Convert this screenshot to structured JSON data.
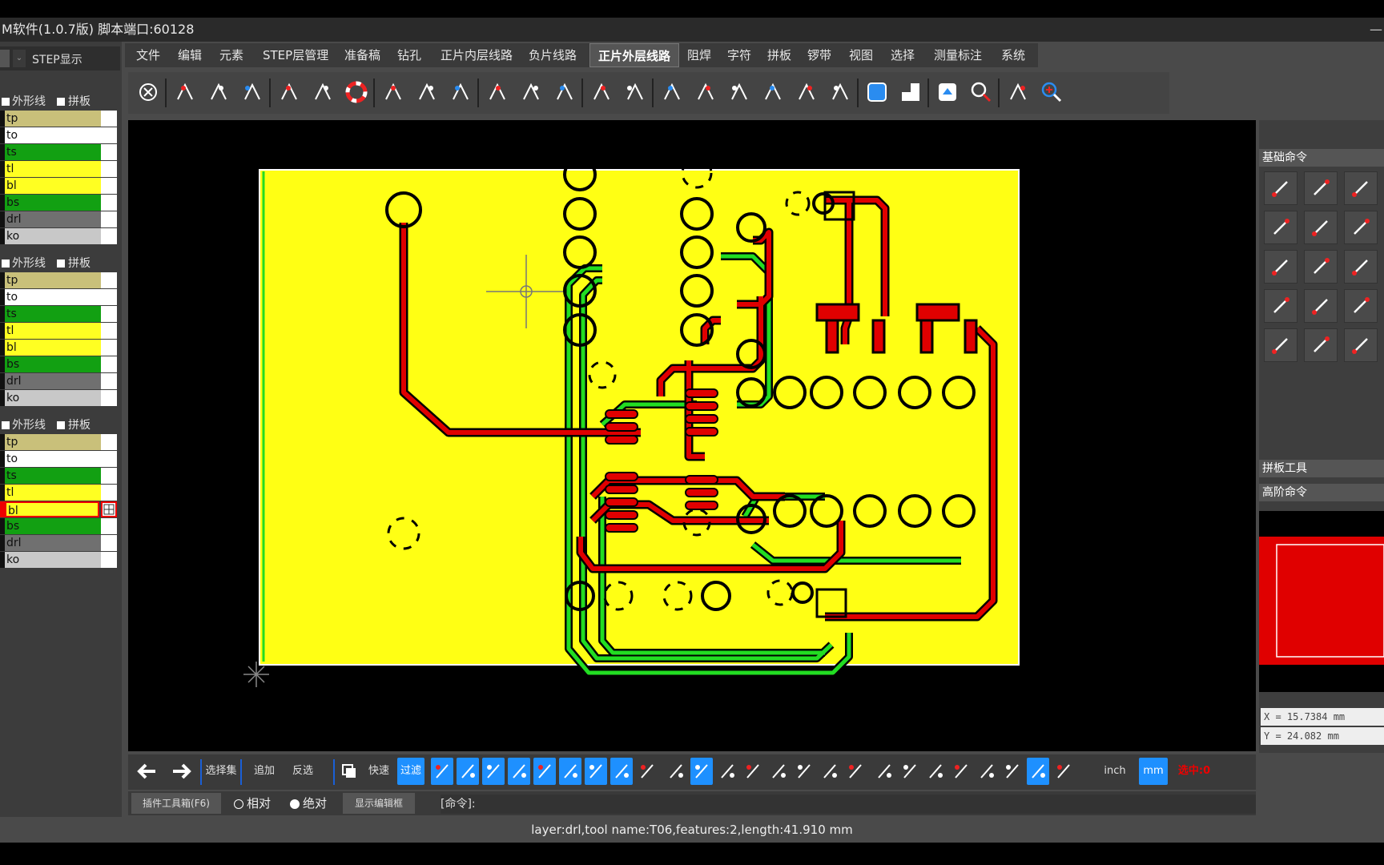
{
  "window": {
    "title": "M软件(1.0.7版) 脚本端口:60128",
    "min_glyph": "—"
  },
  "left_panel": {
    "header_label": "STEP显示",
    "groups": [
      {
        "check1": "外形线",
        "check2": "拼板",
        "layers": [
          "tp",
          "to",
          "ts",
          "tl",
          "bl",
          "bs",
          "drl",
          "ko"
        ]
      },
      {
        "check1": "外形线",
        "check2": "拼板",
        "layers": [
          "tp",
          "to",
          "ts",
          "tl",
          "bl",
          "bs",
          "drl",
          "ko"
        ]
      },
      {
        "check1": "外形线",
        "check2": "拼板",
        "layers": [
          "tp",
          "to",
          "ts",
          "tl",
          "bl",
          "bs",
          "drl",
          "ko"
        ],
        "selected_layer": "bl"
      }
    ],
    "layer_colors": {
      "tp": "#c9c07a",
      "to": "#ffffff",
      "ts": "#12a012",
      "tl": "#ffff22",
      "bl": "#ffff22",
      "bs": "#12a012",
      "drl": "#707070",
      "ko": "#c8c8c8"
    }
  },
  "menu": {
    "items": [
      "文件",
      "编辑",
      "元素",
      "STEP层管理",
      "准备稿",
      "钻孔",
      "正片内层线路",
      "负片线路",
      "正片外层线路",
      "阻焊",
      "字符",
      "拼板",
      "锣带",
      "视图",
      "选择",
      "测量标注",
      "系统"
    ],
    "active": "正片外层线路"
  },
  "toolbar": {
    "icons": [
      "cancel-icon",
      "route-icon",
      "route-corner-icon",
      "probe-icon",
      "frame-icon",
      "pen-icon",
      "lifebuoy-icon",
      "grid-dots-icon",
      "grid-icon",
      "grid-fill-icon",
      "select-region-icon",
      "mirror-icon",
      "swap-icon",
      "move-icon",
      "arc-icon",
      "bridge-icon",
      "bars-icon",
      "comb-icon",
      "waves-icon",
      "tree-icon",
      "user-pin-icon",
      "fit-icon",
      "layer-a-icon",
      "layer-b-icon",
      "zoom-icon",
      "stack-icon",
      "zoom-in-icon"
    ]
  },
  "right_panel": {
    "basic_title": "基础命令",
    "panel_tool_title": "拼板工具",
    "advanced_title": "高阶命令",
    "coord_x": "X = 15.7384 mm",
    "coord_y": "Y = 24.082 mm"
  },
  "bottom_toolbar": {
    "select_set": "选择集",
    "append": "追加",
    "invert": "反选",
    "fast": "快速",
    "filter": "过滤",
    "unit_inch": "inch",
    "unit_mm": "mm",
    "selected_count": "选中:0"
  },
  "command_row": {
    "plugin_box": "插件工具箱(F6)",
    "relative": "相对",
    "absolute": "绝对",
    "show_editor": "显示编辑框",
    "cmd_label": "[命令]:"
  },
  "status": {
    "text": "layer:drl,tool name:T06,features:2,length:41.910 mm"
  },
  "colors": {
    "board_fill": "#ffff14",
    "trace_top": "#e00000",
    "trace_bottom": "#22dd22",
    "pad_stroke": "#000000"
  }
}
